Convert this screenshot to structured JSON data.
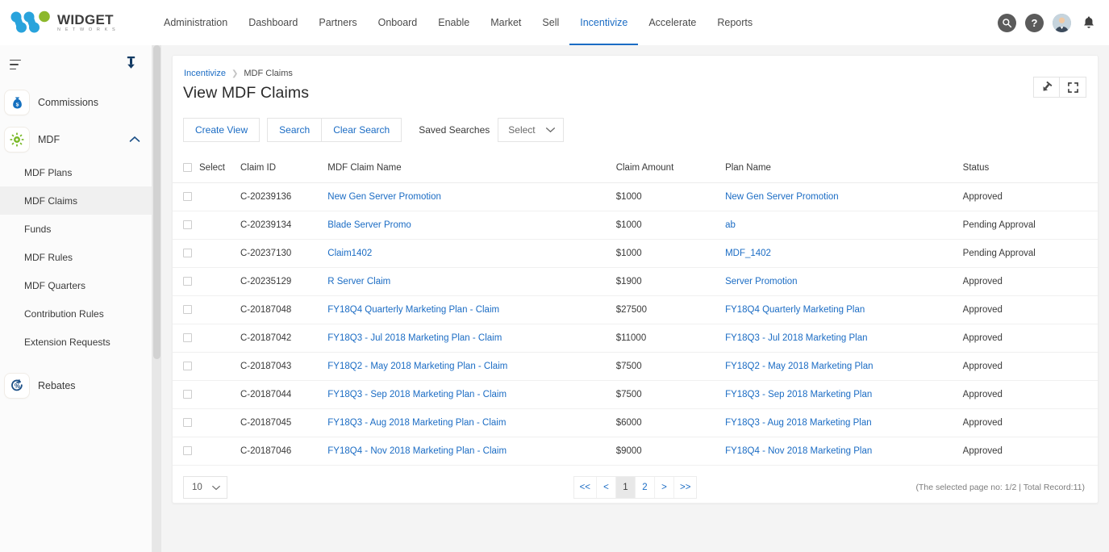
{
  "brand": {
    "title": "WIDGET",
    "subtitle": "N E T W O R K S",
    "accent_blue": "#29a3dc",
    "accent_green": "#8cb82b",
    "link_blue": "#1b6cc4"
  },
  "topnav": {
    "items": [
      {
        "label": "Administration",
        "active": false
      },
      {
        "label": "Dashboard",
        "active": false
      },
      {
        "label": "Partners",
        "active": false
      },
      {
        "label": "Onboard",
        "active": false
      },
      {
        "label": "Enable",
        "active": false
      },
      {
        "label": "Market",
        "active": false
      },
      {
        "label": "Sell",
        "active": false
      },
      {
        "label": "Incentivize",
        "active": true
      },
      {
        "label": "Accelerate",
        "active": false
      },
      {
        "label": "Reports",
        "active": false
      }
    ],
    "icons": [
      "search-icon",
      "help-icon",
      "avatar",
      "notifications-bell-icon"
    ]
  },
  "sidebar": {
    "menu_icon": "hamburger-icon",
    "pin_icon": "pin-icon",
    "groups": [
      {
        "label": "Commissions",
        "icon": "money-bag-icon",
        "expanded": false
      },
      {
        "label": "MDF",
        "icon": "mdf-sun-icon",
        "expanded": true
      },
      {
        "label": "Rebates",
        "icon": "rebate-percent-icon",
        "expanded": false
      }
    ],
    "mdf_items": [
      {
        "label": "MDF Plans",
        "active": false
      },
      {
        "label": "MDF Claims",
        "active": true
      },
      {
        "label": "Funds",
        "active": false
      },
      {
        "label": "MDF Rules",
        "active": false
      },
      {
        "label": "MDF Quarters",
        "active": false
      },
      {
        "label": "Contribution Rules",
        "active": false
      },
      {
        "label": "Extension Requests",
        "active": false
      }
    ]
  },
  "breadcrumb": {
    "parent": "Incentivize",
    "separator": "❯",
    "current": "MDF Claims"
  },
  "page": {
    "title": "View MDF Claims",
    "pin_button": "pin-icon",
    "expand_button": "fullscreen-icon"
  },
  "toolbar": {
    "create_view": "Create View",
    "search": "Search",
    "clear_search": "Clear Search",
    "saved_searches_label": "Saved Searches",
    "saved_searches_value": "Select"
  },
  "table": {
    "columns": [
      "Select",
      "Claim ID",
      "MDF Claim Name",
      "Claim Amount",
      "Plan Name",
      "Status"
    ],
    "rows": [
      {
        "claim_id": "C-20239136",
        "claim_name": "New Gen Server Promotion",
        "amount": "$1000",
        "plan": "New Gen Server Promotion",
        "status": "Approved"
      },
      {
        "claim_id": "C-20239134",
        "claim_name": "Blade Server Promo",
        "amount": "$1000",
        "plan": "ab",
        "status": "Pending Approval"
      },
      {
        "claim_id": "C-20237130",
        "claim_name": "Claim1402",
        "amount": "$1000",
        "plan": "MDF_1402",
        "status": "Pending Approval"
      },
      {
        "claim_id": "C-20235129",
        "claim_name": "R Server Claim",
        "amount": "$1900",
        "plan": "Server Promotion",
        "status": "Approved"
      },
      {
        "claim_id": "C-20187048",
        "claim_name": "FY18Q4 Quarterly Marketing Plan - Claim",
        "amount": "$27500",
        "plan": "FY18Q4 Quarterly Marketing Plan",
        "status": "Approved"
      },
      {
        "claim_id": "C-20187042",
        "claim_name": "FY18Q3 - Jul 2018 Marketing Plan - Claim",
        "amount": "$11000",
        "plan": "FY18Q3 - Jul 2018 Marketing Plan",
        "status": "Approved"
      },
      {
        "claim_id": "C-20187043",
        "claim_name": "FY18Q2 - May 2018 Marketing Plan - Claim",
        "amount": "$7500",
        "plan": "FY18Q2 - May 2018 Marketing Plan",
        "status": "Approved"
      },
      {
        "claim_id": "C-20187044",
        "claim_name": "FY18Q3 - Sep 2018 Marketing Plan - Claim",
        "amount": "$7500",
        "plan": "FY18Q3 - Sep 2018 Marketing Plan",
        "status": "Approved"
      },
      {
        "claim_id": "C-20187045",
        "claim_name": "FY18Q3 - Aug 2018 Marketing Plan - Claim",
        "amount": "$6000",
        "plan": "FY18Q3 - Aug 2018 Marketing Plan",
        "status": "Approved"
      },
      {
        "claim_id": "C-20187046",
        "claim_name": "FY18Q4 - Nov 2018 Marketing Plan - Claim",
        "amount": "$9000",
        "plan": "FY18Q4 - Nov 2018 Marketing Plan",
        "status": "Approved"
      }
    ]
  },
  "footer": {
    "page_size": "10",
    "pager": [
      {
        "label": "<<",
        "active": false
      },
      {
        "label": "<",
        "active": false
      },
      {
        "label": "1",
        "active": true
      },
      {
        "label": "2",
        "active": false
      },
      {
        "label": ">",
        "active": false
      },
      {
        "label": ">>",
        "active": false
      }
    ],
    "record_info": "(The selected page no: 1/2 | Total Record:11)"
  }
}
